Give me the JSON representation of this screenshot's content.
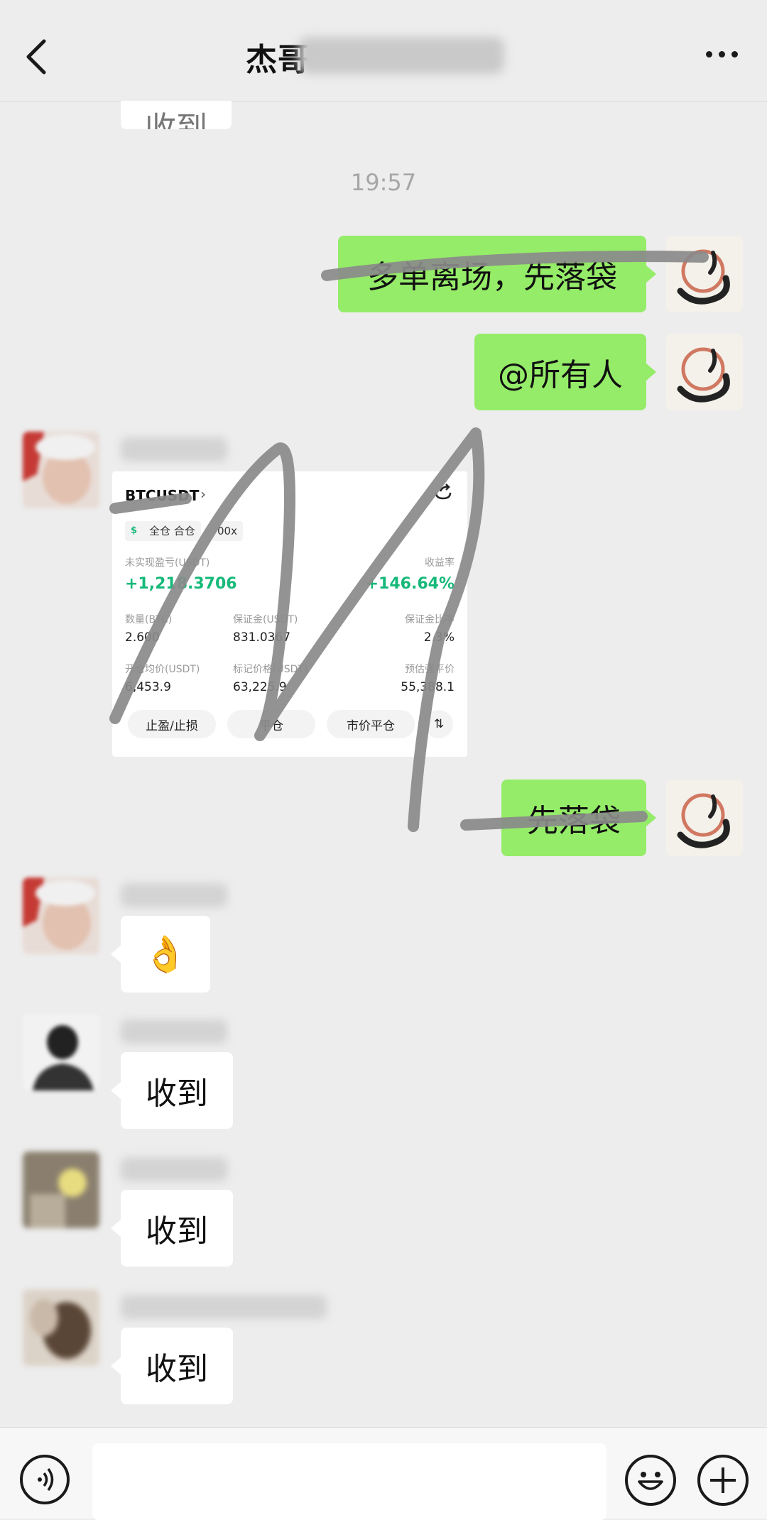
{
  "header": {
    "title": "杰哥"
  },
  "timestamp": "19:57",
  "messages": {
    "partial_top": "收到",
    "me_1": "多单离场，先落袋",
    "me_2": "@所有人",
    "me_3": "先落袋",
    "reply_emoji": "👌",
    "reply_2": "收到",
    "reply_3": "收到",
    "reply_4": "收到"
  },
  "card": {
    "symbol": "BTCUSDT",
    "mode": "全仓 合仓",
    "leverage": "00x",
    "unrealized_label": "未实现盈亏(USDT)",
    "unrealized_value": "+1,218.3706",
    "roe_label": "收益率",
    "roe_value": "+146.64%",
    "qty_label": "数量(BTC)",
    "qty_value": "2.600",
    "margin_label": "保证金(USDT)",
    "margin_value": "831.0367",
    "margin_ratio_label": "保证金比率",
    "margin_ratio_value": "2.3%",
    "entry_label": "开仓均价(USDT)",
    "entry_value": "6,453.9",
    "mark_label": "标记价格(USDT)",
    "mark_value": "63,225.9",
    "liq_label": "预估强平价",
    "liq_value": "55,388.1",
    "btn_tpsl": "止盈/止损",
    "btn_close": "平仓",
    "btn_market_close": "市价平仓"
  },
  "colors": {
    "my_bubble": "#95ec69",
    "other_bubble": "#ffffff",
    "background": "#ededed",
    "profit": "#16b979"
  }
}
